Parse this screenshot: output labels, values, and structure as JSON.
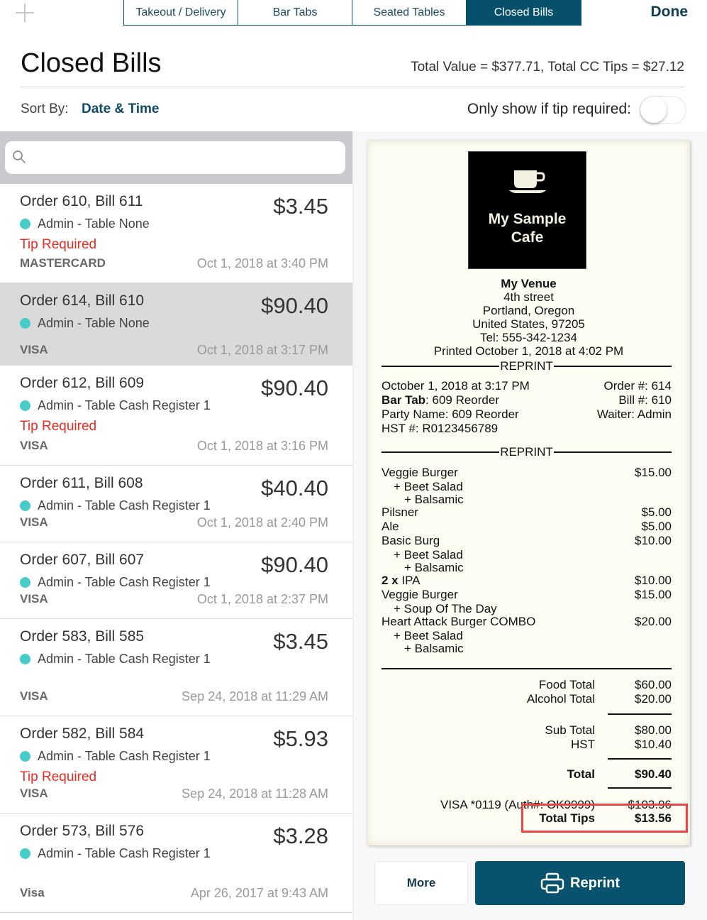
{
  "topbar": {
    "add_icon": "plus-icon",
    "tabs": [
      {
        "label": "Takeout / Delivery",
        "active": false
      },
      {
        "label": "Bar Tabs",
        "active": false
      },
      {
        "label": "Seated Tables",
        "active": false
      },
      {
        "label": "Closed Bills",
        "active": true
      }
    ],
    "done_label": "Done"
  },
  "header": {
    "title": "Closed Bills",
    "totals": "Total Value = $377.71, Total CC Tips = $27.12",
    "sort_label": "Sort By:",
    "sort_value": "Date & Time",
    "tip_filter_label": "Only show if tip required:",
    "tip_filter_on": false
  },
  "search": {
    "placeholder": "",
    "value": "",
    "icon": "search-icon"
  },
  "bills": [
    {
      "title": "Order 610, Bill 611",
      "amount": "$3.45",
      "meta": "Admin - Table None",
      "tip_required": "Tip Required",
      "card": "MASTERCARD",
      "date": "Oct 1, 2018 at 3:40 PM",
      "selected": false
    },
    {
      "title": "Order 614, Bill 610",
      "amount": "$90.40",
      "meta": "Admin - Table None",
      "tip_required": "",
      "card": "VISA",
      "date": "Oct 1, 2018 at 3:17 PM",
      "selected": true
    },
    {
      "title": "Order 612, Bill 609",
      "amount": "$90.40",
      "meta": "Admin - Table Cash Register 1",
      "tip_required": "Tip Required",
      "card": "VISA",
      "date": "Oct 1, 2018 at 3:16 PM",
      "selected": false
    },
    {
      "title": "Order 611, Bill 608",
      "amount": "$40.40",
      "meta": "Admin - Table Cash Register 1",
      "tip_required": "",
      "card": "VISA",
      "date": "Oct 1, 2018 at 2:40 PM",
      "selected": false
    },
    {
      "title": "Order 607, Bill 607",
      "amount": "$90.40",
      "meta": "Admin - Table Cash Register 1",
      "tip_required": "",
      "card": "VISA",
      "date": "Oct 1, 2018 at 2:37 PM",
      "selected": false
    },
    {
      "title": "Order 583, Bill 585",
      "amount": "$3.45",
      "meta": "Admin - Table Cash Register 1",
      "tip_required": "",
      "card": "VISA",
      "date": "Sep 24, 2018 at 11:29 AM",
      "selected": false
    },
    {
      "title": "Order 582, Bill 584",
      "amount": "$5.93",
      "meta": "Admin - Table Cash Register 1",
      "tip_required": "Tip Required",
      "card": "VISA",
      "date": "Sep 24, 2018 at 11:28 AM",
      "selected": false
    },
    {
      "title": "Order 573, Bill 576",
      "amount": "$3.28",
      "meta": "Admin - Table Cash Register 1",
      "tip_required": "",
      "card": "Visa",
      "date": "Apr 26, 2017 at 9:43 AM",
      "selected": false
    }
  ],
  "receipt": {
    "logo_line1": "My Sample",
    "logo_line2": "Cafe",
    "venue_name": "My Venue",
    "address1": "4th street",
    "address2": "Portland, Oregon",
    "address3": "United States, 97205",
    "phone": "Tel: 555-342-1234",
    "printed": "Printed October 1, 2018 at 4:02 PM",
    "reprint_label": "REPRINT",
    "datetime": "October 1, 2018 at 3:17 PM",
    "bar_tab_label": "Bar Tab",
    "bar_tab_value": ": 609 Reorder",
    "party_name": "Party Name: 609 Reorder",
    "hst_number": "HST #: R0123456789",
    "order_no": "Order #: 614",
    "bill_no": "Bill #: 610",
    "waiter": "Waiter: Admin",
    "items": [
      {
        "name": "Veggie Burger",
        "qty": "",
        "price": "$15.00",
        "mods": [
          "+ Beet Salad",
          "+ Balsamic"
        ]
      },
      {
        "name": "Pilsner",
        "qty": "",
        "price": "$5.00",
        "mods": []
      },
      {
        "name": "Ale",
        "qty": "",
        "price": "$5.00",
        "mods": []
      },
      {
        "name": "Basic Burg",
        "qty": "",
        "price": "$10.00",
        "mods": [
          "+ Beet Salad",
          "+ Balsamic"
        ]
      },
      {
        "name": "IPA",
        "qty": "2 x ",
        "price": "$10.00",
        "mods": []
      },
      {
        "name": "Veggie Burger",
        "qty": "",
        "price": "$15.00",
        "mods": [
          "+ Soup Of The Day"
        ]
      },
      {
        "name": "Heart Attack Burger COMBO",
        "qty": "",
        "price": "$20.00",
        "mods": [
          "+ Beet Salad",
          "+ Balsamic"
        ]
      }
    ],
    "food_total_label": "Food Total",
    "food_total": "$60.00",
    "alcohol_total_label": "Alcohol Total",
    "alcohol_total": "$20.00",
    "sub_total_label": "Sub Total",
    "sub_total": "$80.00",
    "hst_label": "HST",
    "hst": "$10.40",
    "total_label": "Total",
    "total": "$90.40",
    "payment_label": "VISA *0119 (Auth#: OK9999)",
    "payment_amount": "$103.96",
    "total_tips_label": "Total Tips",
    "total_tips": "$13.56"
  },
  "actions": {
    "more_label": "More",
    "reprint_label": "Reprint"
  },
  "colors": {
    "accent": "#07506b",
    "tip_required": "#ec2b22",
    "status_dot": "#47ccc9",
    "highlight": "#ee4444"
  }
}
